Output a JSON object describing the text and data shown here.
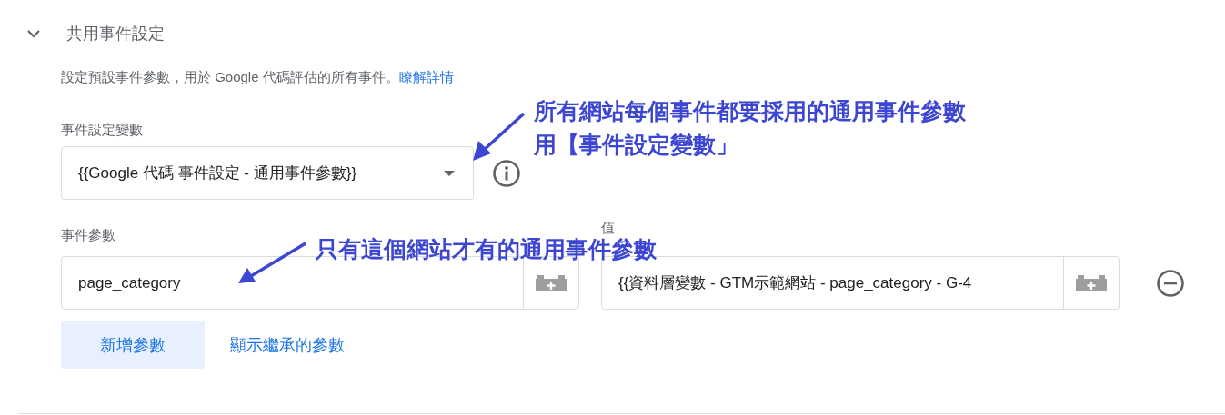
{
  "section": {
    "title": "共用事件設定",
    "expanded": true,
    "description": "設定預設事件參數，用於 Google 代碼評估的所有事件。",
    "learn_more_link": "瞭解詳情"
  },
  "settings_variable": {
    "label": "事件設定變數",
    "value": "{{Google 代碼 事件設定 - 通用事件參數}}"
  },
  "event_parameters": {
    "label": "事件參數",
    "value_label": "值",
    "rows": [
      {
        "parameter": "page_category",
        "value": "{{資料層變數 - GTM示範網站 - page_category - G-4"
      }
    ]
  },
  "buttons": {
    "add_parameter": "新增參數",
    "show_inherited": "顯示繼承的參數"
  },
  "annotations": [
    {
      "lines": [
        "所有網站每個事件都要採用的通用事件參數",
        "用【事件設定變數」"
      ]
    },
    {
      "lines": [
        "只有這個網站才有的通用事件參數"
      ]
    }
  ]
}
